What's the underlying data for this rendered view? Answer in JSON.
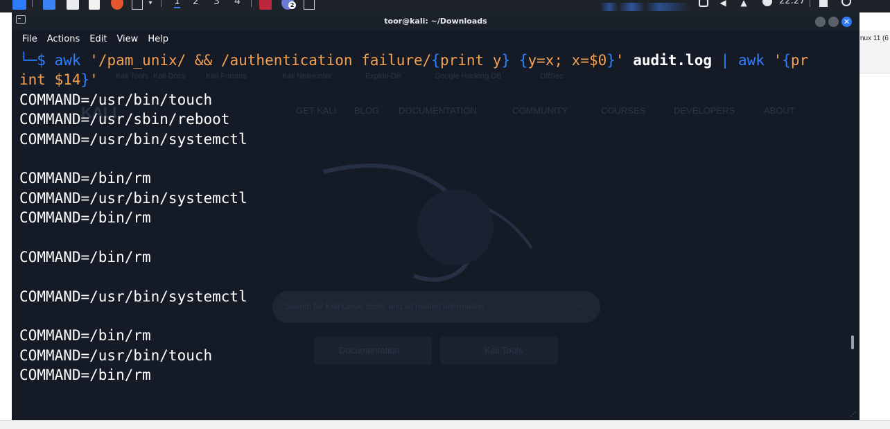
{
  "taskbar": {
    "workspaces": [
      "1",
      "2",
      "3",
      "4"
    ],
    "active_workspace": "1",
    "notification_badge": "2",
    "clock": "22:27"
  },
  "background": {
    "right_tab_fragment": "nux 11 (6",
    "page_links": [
      "Kali Tools",
      "Kali Docs",
      "Kali Forums",
      "Kali NetHunter",
      "Exploit-DB",
      "Google Hacking DB",
      "OffSec"
    ],
    "page_nav": [
      "GET KALI",
      "BLOG",
      "DOCUMENTATION",
      "COMMUNITY",
      "COURSES",
      "DEVELOPERS",
      "ABOUT"
    ],
    "search_placeholder": "Search for Kali Linux, tools, and all related information",
    "buttons": [
      "Documentation",
      "Kali Tools"
    ],
    "brand_fragment": "KALI"
  },
  "terminal": {
    "title": "toor@kali: ~/Downloads",
    "close_glyph": "✕",
    "menu": [
      "File",
      "Actions",
      "Edit",
      "View",
      "Help"
    ],
    "command": {
      "prompt_prefix": "└─",
      "prompt_symbol": "$",
      "cmd1": "awk",
      "script1_open": "'/pam_unix/ && /authentication failure/",
      "brace1_open": "{",
      "script1_body": "print y",
      "brace1_close": "}",
      "brace2_open": "{",
      "script1_body2": "y=x; x=$0",
      "brace2_close": "}",
      "quote_close": "'",
      "file": "audit.log",
      "pipe": "|",
      "cmd2": "awk",
      "script2_open": "'",
      "brace3_open": "{",
      "script2_part1": "pr",
      "script2_part2": "int $14",
      "brace3_close": "}",
      "script2_close": "'"
    },
    "output_lines": [
      "COMMAND=/usr/bin/touch",
      "COMMAND=/usr/sbin/reboot",
      "COMMAND=/usr/bin/systemctl",
      "",
      "COMMAND=/bin/rm",
      "COMMAND=/usr/bin/systemctl",
      "COMMAND=/bin/rm",
      "",
      "COMMAND=/bin/rm",
      "",
      "COMMAND=/usr/bin/systemctl",
      "",
      "COMMAND=/bin/rm",
      "COMMAND=/usr/bin/touch",
      "COMMAND=/bin/rm"
    ]
  }
}
